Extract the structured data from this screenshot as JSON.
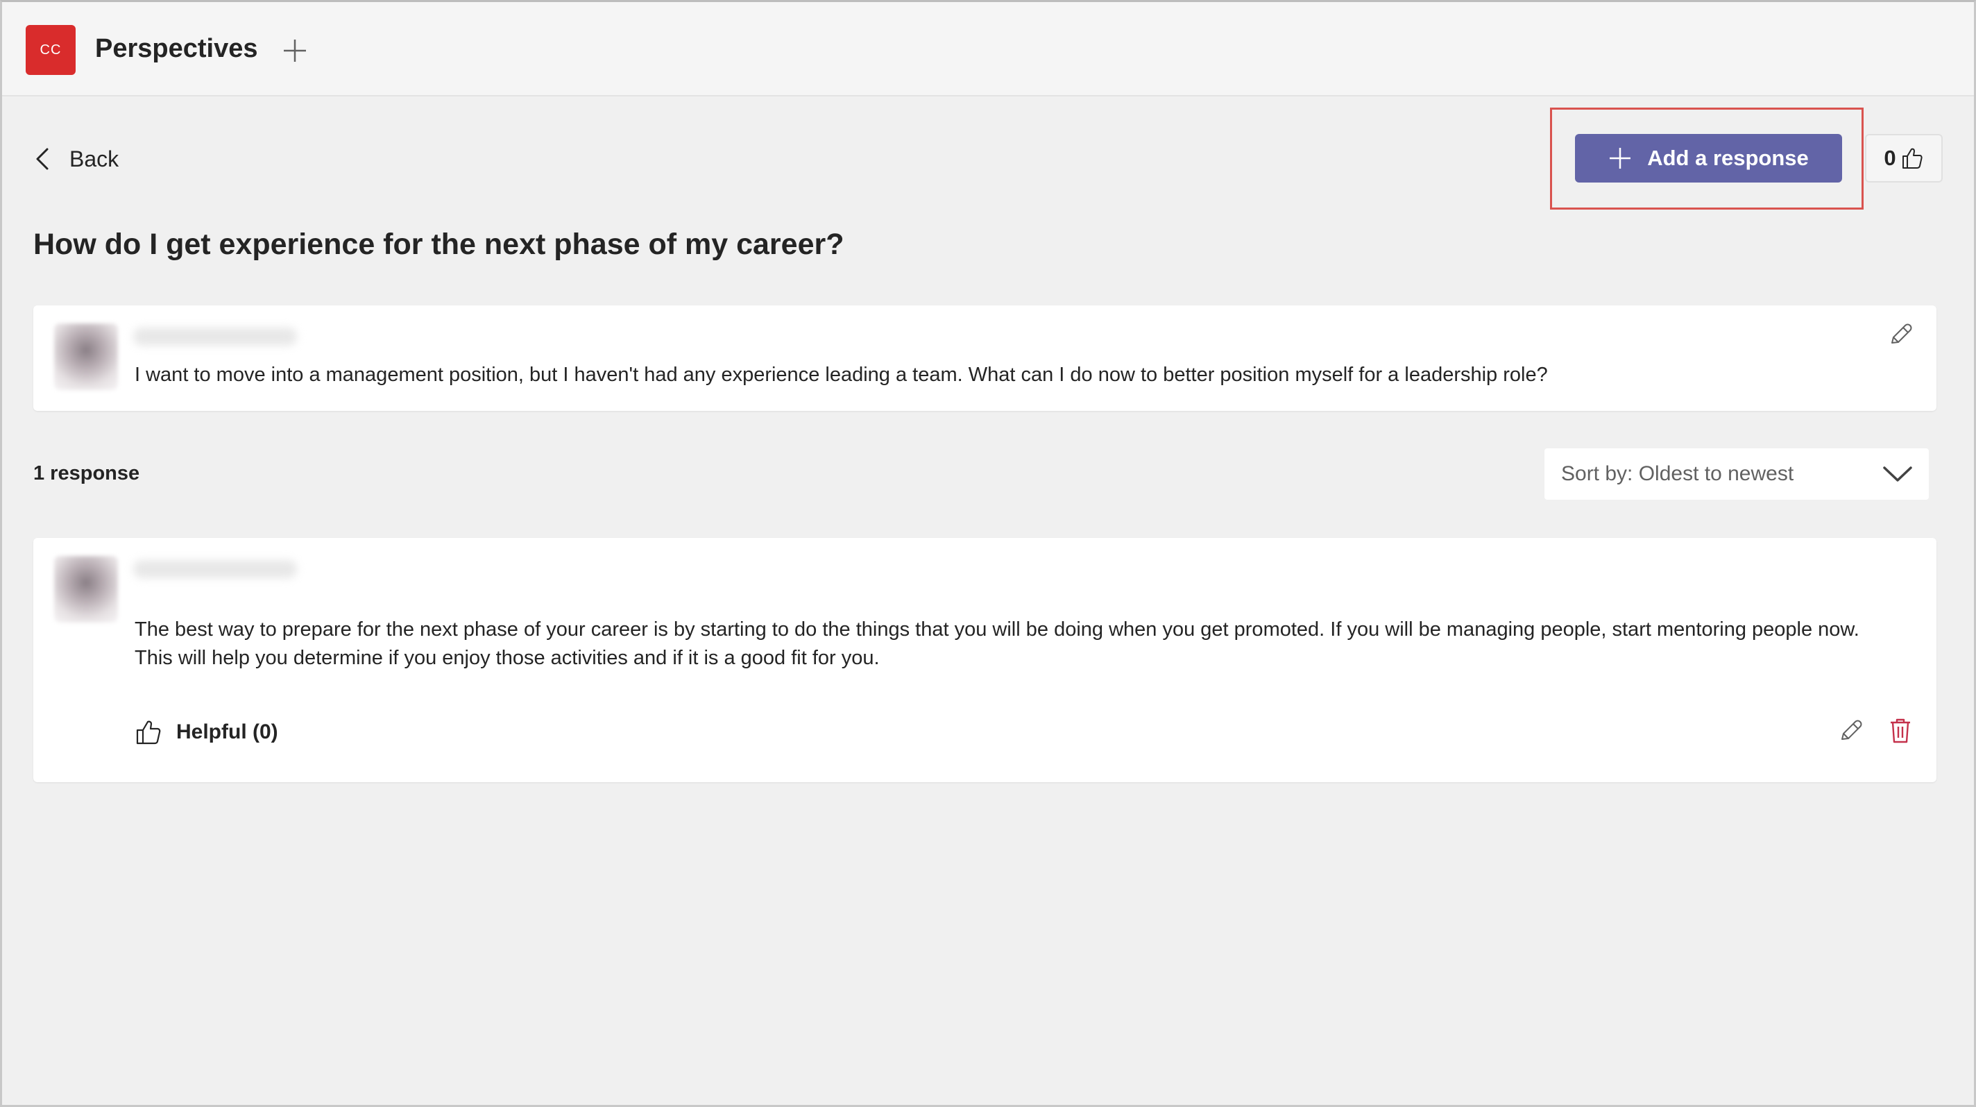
{
  "app": {
    "badge": "CC",
    "title": "Perspectives"
  },
  "nav": {
    "back_label": "Back"
  },
  "toolbar": {
    "add_response_label": "Add a response",
    "like_count": "0"
  },
  "question": {
    "title": "How do I get experience for the next phase of my career?",
    "body": "I want to move into a management position, but I haven't had any experience leading a team. What can I do now to better position myself for a leadership role?"
  },
  "responses": {
    "count_label": "1 response",
    "sort_label": "Sort by: Oldest to newest",
    "items": [
      {
        "body": "The best way to prepare for the next phase of your career is by starting to do the things that you will be doing when you get promoted. If you will be managing people, start mentoring people now. This will help you determine if you enjoy those activities and if it is a good fit for you.",
        "helpful_label": "Helpful (0)"
      }
    ]
  },
  "colors": {
    "accent": "#6264a7",
    "badge": "#d92c2c",
    "highlight": "#d9534f",
    "delete": "#c4314b"
  }
}
